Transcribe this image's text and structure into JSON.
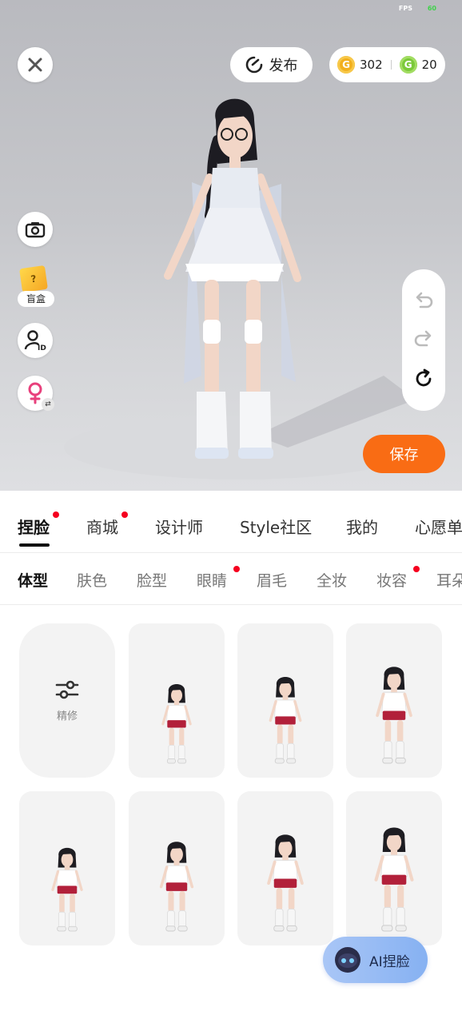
{
  "status": {
    "fps_label": "FPS",
    "fps_value": "60"
  },
  "top_bar": {
    "publish_label": "发布",
    "currency": {
      "gold": "302",
      "green": "20"
    }
  },
  "left_tools": {
    "blindbox_label": "盲盒"
  },
  "save_label": "保存",
  "main_tabs": [
    {
      "label": "捏脸",
      "active": true,
      "dot": true
    },
    {
      "label": "商城",
      "dot": true
    },
    {
      "label": "设计师"
    },
    {
      "label": "Style社区"
    },
    {
      "label": "我的"
    },
    {
      "label": "心愿单"
    }
  ],
  "sub_tabs": [
    {
      "label": "体型",
      "active": true
    },
    {
      "label": "肤色"
    },
    {
      "label": "脸型"
    },
    {
      "label": "眼睛",
      "dot": true
    },
    {
      "label": "眉毛"
    },
    {
      "label": "全妆"
    },
    {
      "label": "妆容",
      "dot": true
    },
    {
      "label": "耳朵"
    }
  ],
  "grid": {
    "fine_tune_label": "精修",
    "presets": [
      "body-preset-1",
      "body-preset-2",
      "body-preset-3",
      "body-preset-4",
      "body-preset-5",
      "body-preset-6",
      "body-preset-7"
    ]
  },
  "ai_face_label": "AI捏脸",
  "colors": {
    "accent": "#f96c14",
    "dot": "#f5001f",
    "ai_button": "#9dbcf5"
  }
}
